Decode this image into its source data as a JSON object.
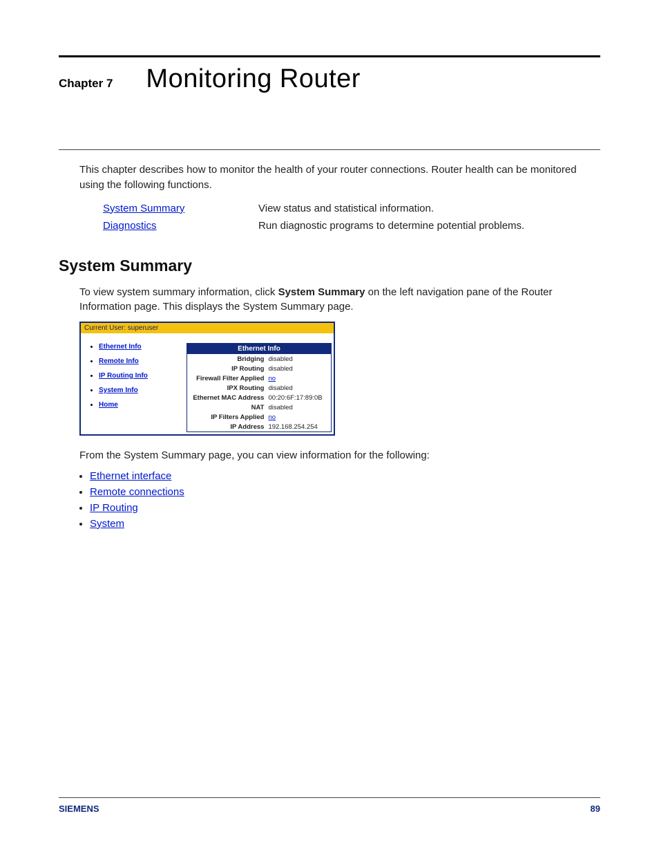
{
  "chapter": {
    "label": "Chapter 7",
    "title": "Monitoring Router"
  },
  "intro": "This chapter describes how to monitor the health of your router connections. Router health can be monitored using the following functions.",
  "functions": [
    {
      "link": "System Summary",
      "desc": "View status and statistical information."
    },
    {
      "link": "Diagnostics",
      "desc": "Run diagnostic programs to determine potential problems."
    }
  ],
  "section": {
    "heading": "System Summary",
    "body_pre": "To view system summary information, click ",
    "body_bold": "System Summary",
    "body_post": " on the left navigation pane of the Router Information page. This displays the System Summary page."
  },
  "screenshot": {
    "topbar": "Current User: superuser",
    "nav": [
      "Ethernet Info",
      "Remote Info",
      "IP Routing Info",
      "System Info",
      "Home"
    ],
    "panel_title": "Ethernet Info",
    "rows": [
      {
        "k": "Bridging",
        "v": "disabled"
      },
      {
        "k": "IP Routing",
        "v": "disabled"
      },
      {
        "k": "Firewall Filter Applied",
        "v": "no",
        "vlink": true
      },
      {
        "k": "IPX Routing",
        "v": "disabled"
      },
      {
        "k": "Ethernet MAC Address",
        "v": "00:20:6F:17:89:0B"
      },
      {
        "k": "NAT",
        "v": "disabled"
      },
      {
        "k": "IP Filters Applied",
        "v": "no",
        "vlink": true
      },
      {
        "k": "IP Address",
        "v": "192.168.254.254"
      }
    ]
  },
  "after_text": "From the System Summary page, you can view information for the following:",
  "after_links": [
    "Ethernet interface",
    "Remote connections",
    "IP Routing",
    "System"
  ],
  "footer": {
    "brand": "SIEMENS",
    "page": "89"
  }
}
